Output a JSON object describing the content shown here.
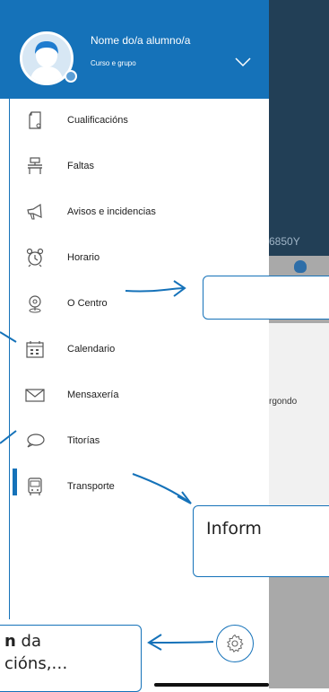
{
  "background_app": {
    "code_fragment": "6850Y",
    "text_fragment": "rgondo"
  },
  "drawer": {
    "student_name": "Nome do/a alumno/a",
    "course": "Curso e grupo",
    "header_color": "#1572b9",
    "expand_icon": "chevron-down-icon"
  },
  "menu": {
    "items": [
      {
        "label": "Cualificacións",
        "icon": "grades-document-icon"
      },
      {
        "label": "Faltas",
        "icon": "school-desk-icon"
      },
      {
        "label": "Avisos e incidencias",
        "icon": "megaphone-icon"
      },
      {
        "label": "Horario",
        "icon": "alarm-clock-icon"
      },
      {
        "label": "O Centro",
        "icon": "location-pin-icon"
      },
      {
        "label": "Calendario",
        "icon": "calendar-icon"
      },
      {
        "label": "Mensaxería",
        "icon": "envelope-icon"
      },
      {
        "label": "Titorías",
        "icon": "chat-bubble-icon"
      },
      {
        "label": "Transporte",
        "icon": "bus-icon"
      }
    ],
    "active_index": 8
  },
  "annotations": {
    "callout_2_text": "Inform",
    "callout_3_bold": "n",
    "callout_3_line1_rest": " da",
    "callout_3_line2": "cións,…"
  },
  "settings": {
    "icon": "gear-icon"
  }
}
